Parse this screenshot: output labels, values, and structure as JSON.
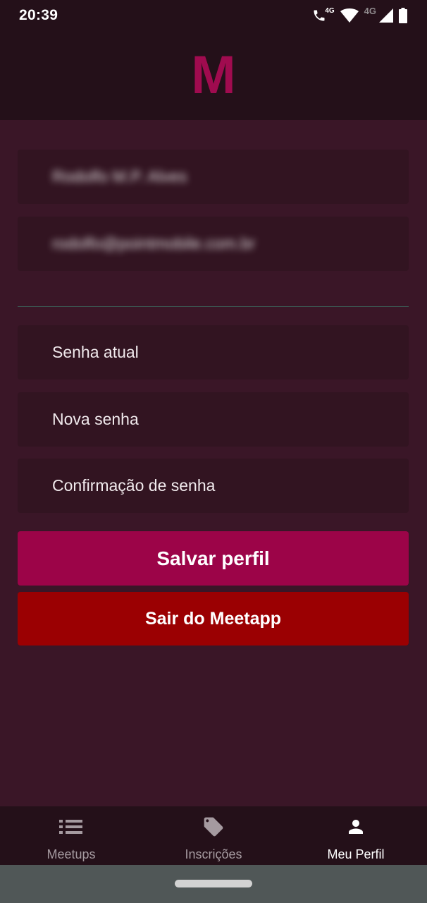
{
  "status_bar": {
    "time": "20:39",
    "icons": [
      "volte-call-icon",
      "wifi-icon",
      "4g-signal-icon",
      "battery-icon"
    ],
    "call_network_label": "4G",
    "signal_network_label": "4G"
  },
  "header": {
    "logo": "M",
    "logo_color": "#a00b4f"
  },
  "profile_form": {
    "name_value": "Rodolfo M.P. Alves",
    "email_value": "rodolfo@pointmobile.com.br",
    "current_password_placeholder": "Senha atual",
    "new_password_placeholder": "Nova senha",
    "confirm_password_placeholder": "Confirmação de senha",
    "save_label": "Salvar perfil",
    "logout_label": "Sair do Meetapp"
  },
  "bottom_nav": {
    "items": [
      {
        "label": "Meetups",
        "icon": "list-icon",
        "active": false
      },
      {
        "label": "Inscrições",
        "icon": "tag-icon",
        "active": false
      },
      {
        "label": "Meu Perfil",
        "icon": "person-icon",
        "active": true
      }
    ]
  },
  "colors": {
    "background": "#3a1627",
    "header": "#241019",
    "field": "#321421",
    "save_button": "#9c0448",
    "logout_button": "#9b0002"
  }
}
